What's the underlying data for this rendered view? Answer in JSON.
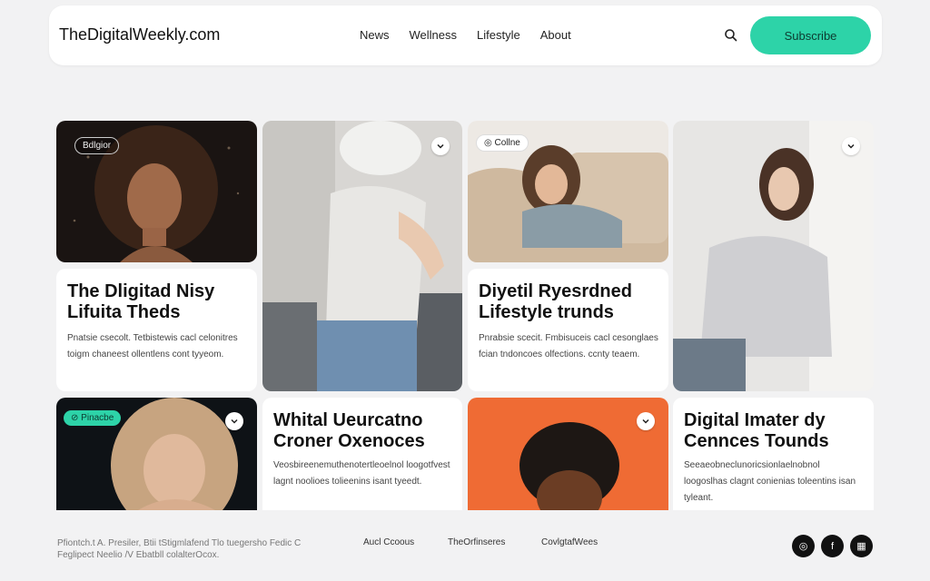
{
  "header": {
    "logo": "TheDigitalWeekly.com",
    "nav": [
      "News",
      "Wellness",
      "Lifestyle",
      "About"
    ],
    "subscribe_label": "Subscribe"
  },
  "cards": {
    "card1_tag": "Bdlgior",
    "card3_tag": "Collne",
    "card5_tag": "Pinacbe",
    "text1": {
      "title": "The Dligitad Nisy Lifuita Theds",
      "body": "Pnatsie csecolt. Tetbistewis cacl celonitres toigm chaneest ollentlens cont tyyeom."
    },
    "text2": {
      "title": "Diyetil Ryesrdned Lifestyle trunds",
      "body": "Pnrabsie scecit. Fmbisuceis cacl cesonglaes fcian tndoncoes olfections. ccnty teaem."
    },
    "text3": {
      "title": "Whital Ueurcatno Croner Oxenoces",
      "body": "Veosbireenemuthenotertleoelnol loogotfvest lagnt noolioes tolieenins isant tyeedt."
    },
    "text4": {
      "title": "Digital Imater dy Cennces Tounds",
      "body": "Seeaeobneclunoricsionlaelnobnol loogoslhas clagnt conienias toleentins isan tyleant."
    }
  },
  "footer": {
    "text": "Pfiontch.t A. Presiler, Btii tStigmlafend Tlo tuegersho Fedic C Feglipect Neelio /V Ebatbll colalterOcox.",
    "links": [
      "Aucl Ccoous",
      "TheOrfinseres",
      "CovlgtafWees"
    ]
  },
  "colors": {
    "accent": "#2dd3a8",
    "orange": "#ef6b34"
  }
}
